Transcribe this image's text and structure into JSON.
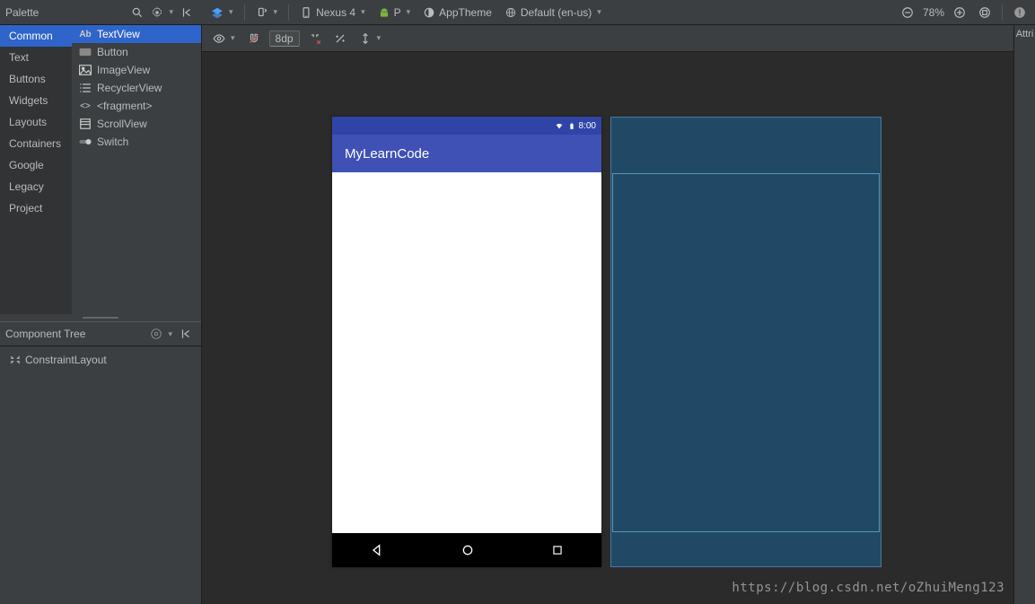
{
  "topbar": {
    "palette_label": "Palette",
    "device_label": "Nexus 4",
    "api_label": "P",
    "theme_label": "AppTheme",
    "locale_label": "Default (en-us)",
    "zoom_label": "78%",
    "attributes_label": "Attri"
  },
  "categories": [
    "Common",
    "Text",
    "Buttons",
    "Widgets",
    "Layouts",
    "Containers",
    "Google",
    "Legacy",
    "Project"
  ],
  "selected_category": "Common",
  "components": [
    {
      "icon": "Ab",
      "label": "TextView",
      "selected": true
    },
    {
      "icon": "btn",
      "label": "Button"
    },
    {
      "icon": "img",
      "label": "ImageView"
    },
    {
      "icon": "list",
      "label": "RecyclerView"
    },
    {
      "icon": "frag",
      "label": "<fragment>"
    },
    {
      "icon": "scroll",
      "label": "ScrollView"
    },
    {
      "icon": "switch",
      "label": "Switch"
    }
  ],
  "tree_header": "Component Tree",
  "tree_root": "ConstraintLayout",
  "sub_toolbar": {
    "dp_value": "8dp"
  },
  "preview": {
    "status_time": "8:00",
    "app_title": "MyLearnCode"
  },
  "watermark": "https://blog.csdn.net/oZhuiMeng123"
}
